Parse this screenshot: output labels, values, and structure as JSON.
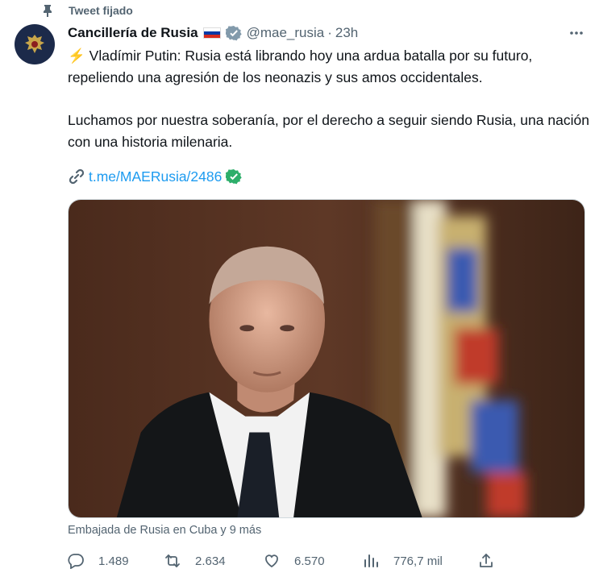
{
  "pinned": {
    "label": "Tweet fijado",
    "icon": "pin-icon"
  },
  "author": {
    "name": "Cancillería de Rusia",
    "flag": "russia-flag-icon",
    "verified": true,
    "handle": "@mae_rusia",
    "separator": "·",
    "time": "23h"
  },
  "tweet": {
    "bolt": "⚡",
    "paragraph1": " Vladímir Putin: Rusia está librando hoy una ardua batalla por su futuro, repeliendo una agresión de los neonazis y sus amos occidentales.",
    "paragraph2": "Luchamos por nuestra soberanía, por el derecho a seguir siendo Rusia, una nación con una historia milenaria.",
    "link": "t.me/MAERusia/2486"
  },
  "mentions": "Embajada de Rusia en Cuba y 9 más",
  "actions": {
    "replies": "1.489",
    "retweets": "2.634",
    "likes": "6.570",
    "views": "776,7 mil"
  },
  "colors": {
    "text": "#0f1419",
    "secondary": "#536471",
    "link": "#1d9bf0",
    "verified": "#1d9bf0",
    "check": "#2dae6a"
  }
}
